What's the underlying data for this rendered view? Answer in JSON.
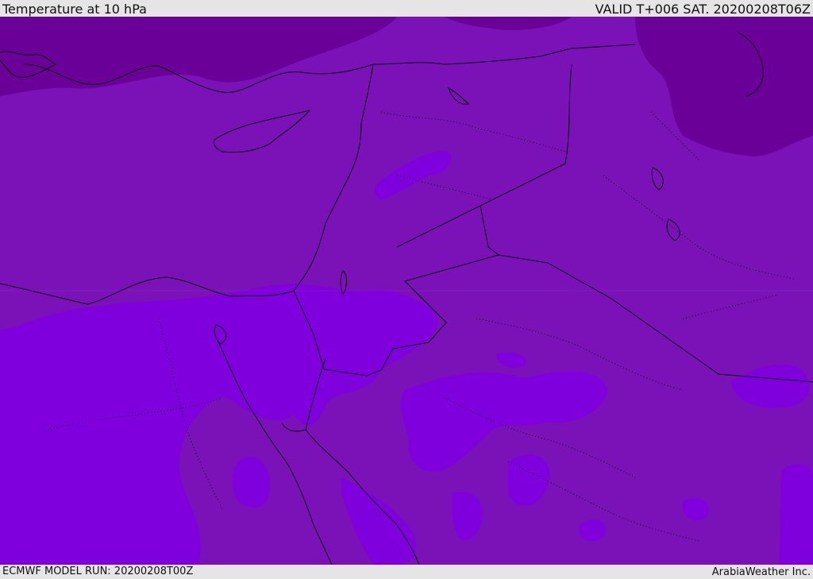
{
  "header": {
    "title": "Temperature at 10 hPa",
    "valid": "VALID T+006 SAT. 20200208T06Z"
  },
  "footer": {
    "model_run": "ECMWF MODEL RUN: 20200208T00Z",
    "credit": "ArabiaWeather Inc."
  },
  "map": {
    "colors": {
      "dark": "#6a0098",
      "mid": "#7a12b8",
      "bright": "#7f00dc",
      "border": "#000000"
    }
  }
}
